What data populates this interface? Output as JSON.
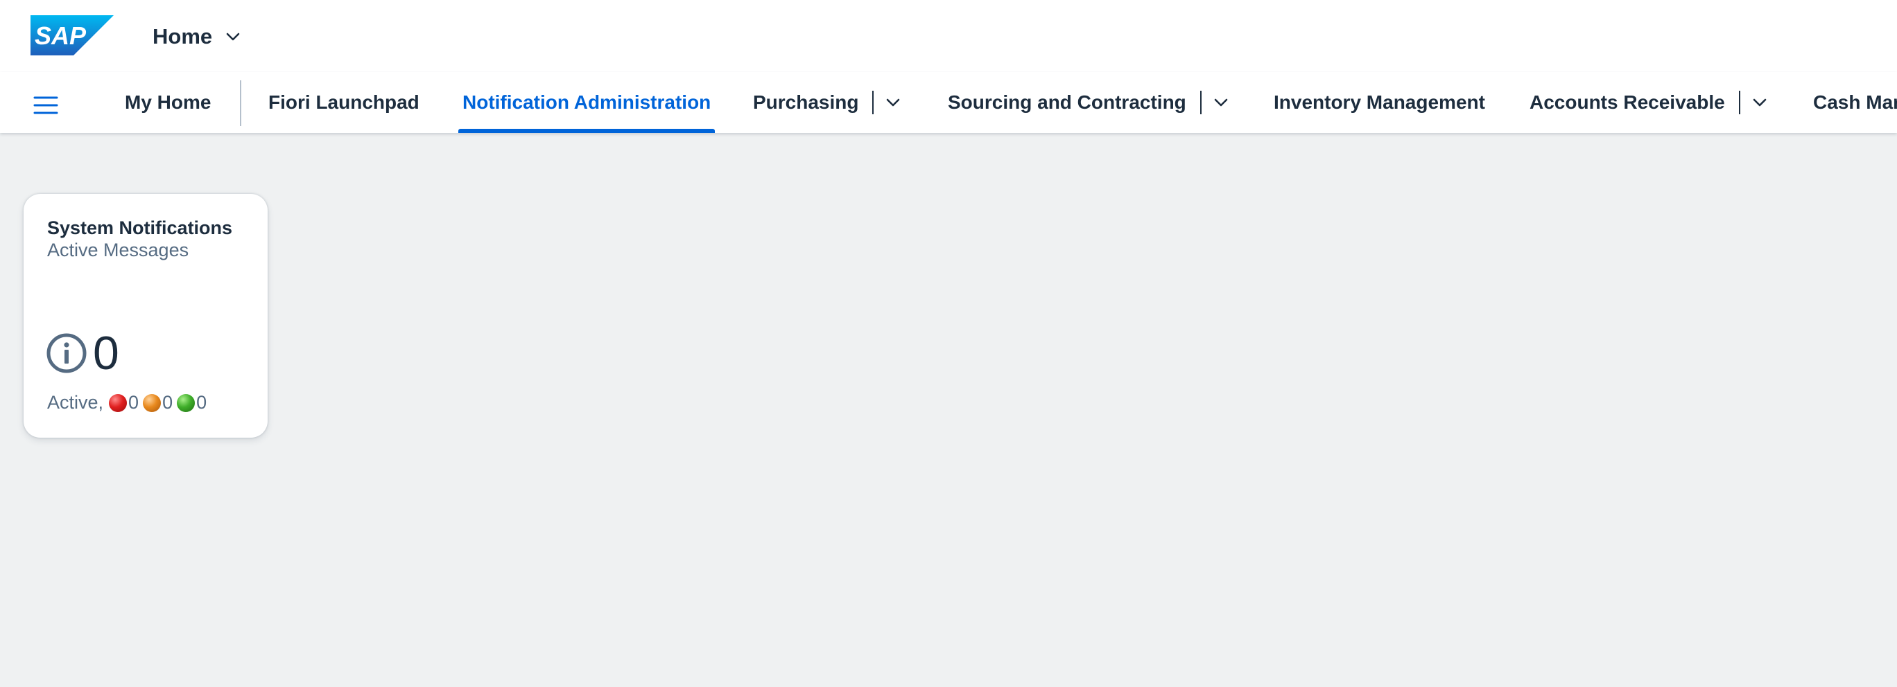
{
  "header": {
    "home_label": "Home"
  },
  "spaces": {
    "tabs": [
      {
        "label": "My Home",
        "selected": false,
        "has_menu": false
      },
      {
        "label": "Fiori Launchpad",
        "selected": false,
        "has_menu": false
      },
      {
        "label": "Notification Administration",
        "selected": true,
        "has_menu": false
      },
      {
        "label": "Purchasing",
        "selected": false,
        "has_menu": true
      },
      {
        "label": "Sourcing and Contracting",
        "selected": false,
        "has_menu": true
      },
      {
        "label": "Inventory Management",
        "selected": false,
        "has_menu": false
      },
      {
        "label": "Accounts Receivable",
        "selected": false,
        "has_menu": true
      },
      {
        "label": "Cash Mar",
        "selected": false,
        "has_menu": false
      }
    ]
  },
  "tile": {
    "title": "System Notifications",
    "subtitle": "Active Messages",
    "kpi_icon": "information-icon",
    "kpi_value": "0",
    "footer_prefix": "Active,",
    "status_counts": {
      "red": "0",
      "orange": "0",
      "green": "0"
    }
  },
  "colors": {
    "accent": "#0064d9",
    "text": "#1d2d3e",
    "secondary_text": "#556b82",
    "background": "#eff1f2"
  }
}
